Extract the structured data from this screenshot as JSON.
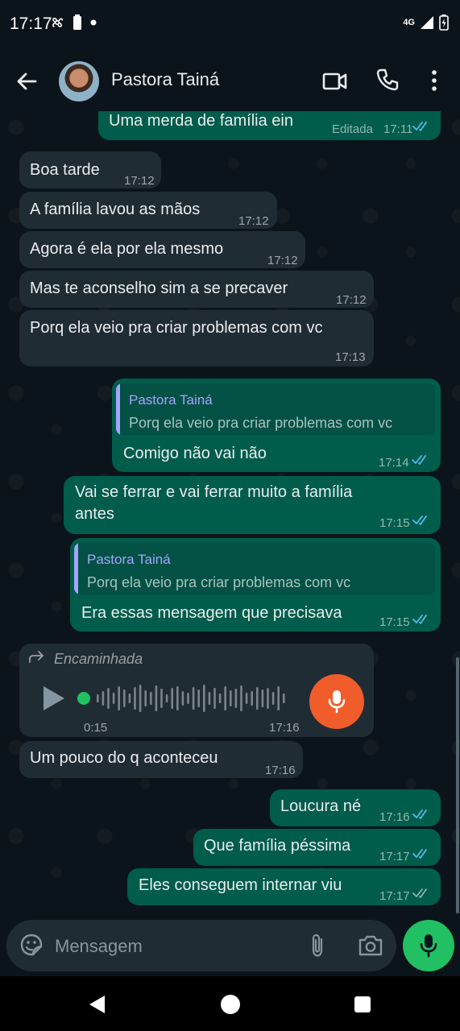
{
  "status_bar": {
    "time": "17:17",
    "network": "4G"
  },
  "header": {
    "contact_name": "Pastora Tainá"
  },
  "messages": [
    {
      "direction": "out",
      "text": "Uma merda de família ein",
      "edited_label": "Editada",
      "time": "17:11",
      "status": "read"
    },
    {
      "direction": "in",
      "text": "Boa tarde",
      "time": "17:12"
    },
    {
      "direction": "in",
      "text": "A família lavou as mãos",
      "time": "17:12"
    },
    {
      "direction": "in",
      "text": "Agora é ela por ela mesmo",
      "time": "17:12"
    },
    {
      "direction": "in",
      "text": "Mas te aconselho sim a se precaver",
      "time": "17:12"
    },
    {
      "direction": "in",
      "text": "Porq ela veio pra criar problemas com vc",
      "time": "17:13"
    },
    {
      "direction": "out",
      "quote_author": "Pastora Tainá",
      "quote_text": "Porq ela veio pra criar problemas com vc",
      "text": "Comigo não vai não",
      "time": "17:14",
      "status": "read"
    },
    {
      "direction": "out",
      "text_line1": "Vai se ferrar e vai ferrar muito a família",
      "text_line2": "antes",
      "time": "17:15",
      "status": "read"
    },
    {
      "direction": "out",
      "quote_author": "Pastora Tainá",
      "quote_text": "Porq ela veio pra criar problemas com vc",
      "text": "Era essas mensagem que precisava",
      "time": "17:15",
      "status": "read"
    },
    {
      "direction": "in",
      "type": "voice",
      "forwarded_label": "Encaminhada",
      "duration": "0:15",
      "time": "17:16",
      "progress": 0
    },
    {
      "direction": "in",
      "text": "Um pouco do q aconteceu",
      "time": "17:16"
    },
    {
      "direction": "out",
      "text": "Loucura né",
      "time": "17:16",
      "status": "read"
    },
    {
      "direction": "out",
      "text": "Que família péssima",
      "time": "17:17",
      "status": "read"
    },
    {
      "direction": "out",
      "text": "Eles conseguem internar viu",
      "time": "17:17",
      "status": "delivered"
    }
  ],
  "composer": {
    "placeholder": "Mensagem"
  },
  "colors": {
    "background": "#0b141a",
    "incoming_bubble": "#202c33",
    "outgoing_bubble": "#005c4b",
    "read_ticks": "#53bdeb",
    "mic_fab": "#21c063",
    "voice_mic_badge": "#f15c2b"
  }
}
